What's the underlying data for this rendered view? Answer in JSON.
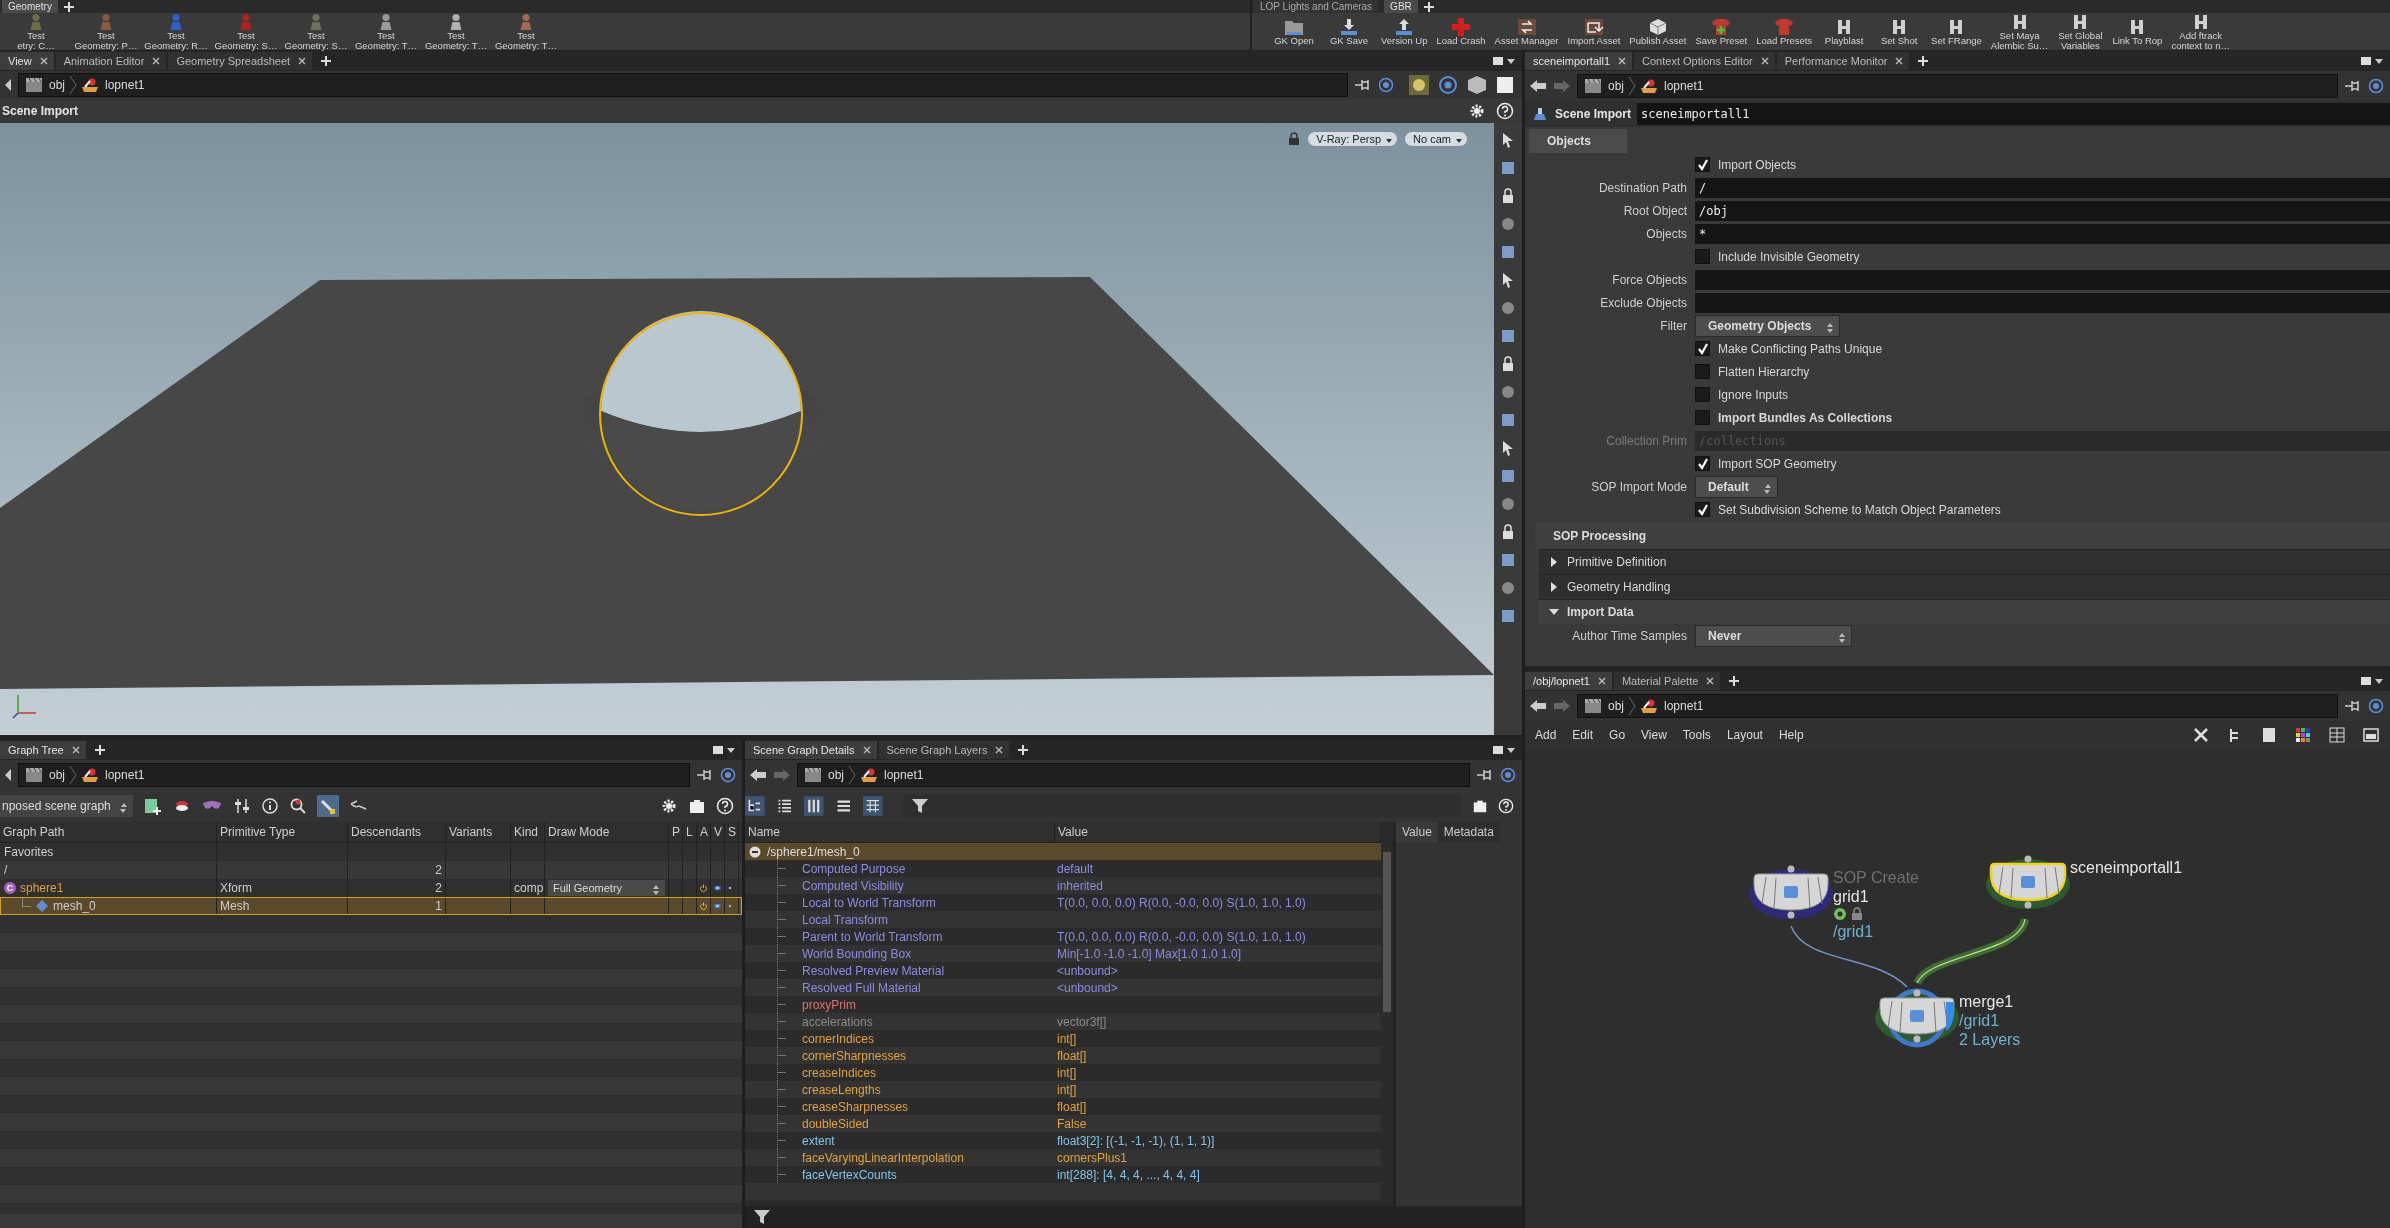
{
  "shelf_left": {
    "tabs": [
      {
        "label": "Geometry",
        "selected": true
      }
    ],
    "tools": [
      {
        "lines": [
          "Test",
          "etry: C…"
        ],
        "color": "#6e6a4a"
      },
      {
        "lines": [
          "Test",
          "Geometry: P…"
        ],
        "color": "#8a5a44"
      },
      {
        "lines": [
          "Test",
          "Geometry: R…"
        ],
        "color": "#2f5fd0"
      },
      {
        "lines": [
          "Test",
          "Geometry: S…"
        ],
        "color": "#b02222"
      },
      {
        "lines": [
          "Test",
          "Geometry: S…"
        ],
        "color": "#6f6f5e"
      },
      {
        "lines": [
          "Test",
          "Geometry: T…"
        ],
        "color": "#9a9a9a"
      },
      {
        "lines": [
          "Test",
          "Geometry: T…"
        ],
        "color": "#b0b0b0"
      },
      {
        "lines": [
          "Test",
          "Geometry: T…"
        ],
        "color": "#a06a50"
      }
    ]
  },
  "shelf_right": {
    "tabs": [
      {
        "label": "LOP Lights and Cameras",
        "selected": false
      },
      {
        "label": "GBR",
        "selected": true
      }
    ],
    "tools": [
      {
        "lines": [
          "GK Open"
        ],
        "kind": "folder"
      },
      {
        "lines": [
          "GK Save"
        ],
        "kind": "download"
      },
      {
        "lines": [
          "Version Up"
        ],
        "kind": "upload"
      },
      {
        "lines": [
          "Load Crash"
        ],
        "kind": "cross"
      },
      {
        "lines": [
          "Asset Manager"
        ],
        "kind": "swap"
      },
      {
        "lines": [
          "Import Asset"
        ],
        "kind": "import"
      },
      {
        "lines": [
          "Publish Asset"
        ],
        "kind": "box"
      },
      {
        "lines": [
          "Save Preset"
        ],
        "kind": "shirtplus"
      },
      {
        "lines": [
          "Load Presets"
        ],
        "kind": "shirt"
      },
      {
        "lines": [
          "Playblast"
        ],
        "kind": "helmet"
      },
      {
        "lines": [
          "Set Shot"
        ],
        "kind": "helmet"
      },
      {
        "lines": [
          "Set FRange"
        ],
        "kind": "helmet"
      },
      {
        "lines": [
          "Set Maya",
          "Alembic Su…"
        ],
        "kind": "helmet"
      },
      {
        "lines": [
          "Set Global",
          "Variables"
        ],
        "kind": "helmet"
      },
      {
        "lines": [
          "Link To Rop"
        ],
        "kind": "helmet"
      },
      {
        "lines": [
          "Add ftrack",
          "context to n…"
        ],
        "kind": "helmet"
      }
    ]
  },
  "viewer": {
    "tabs": [
      {
        "label": "View",
        "selected": true
      },
      {
        "label": "Animation Editor",
        "selected": false
      },
      {
        "label": "Geometry Spreadsheet",
        "selected": false
      }
    ],
    "path": [
      "obj",
      "lopnet1"
    ],
    "title": "Scene Import",
    "camera_menus": [
      "V-Ray: Persp",
      "No cam"
    ]
  },
  "scene_graph_tree": {
    "tabs": [
      {
        "label": "Graph Tree",
        "selected": true
      }
    ],
    "path": [
      "obj",
      "lopnet1"
    ],
    "view_menu": "nposed scene graph",
    "columns": [
      "Graph Path",
      "Primitive Type",
      "Descendants",
      "Variants",
      "Kind",
      "Draw Mode",
      "P",
      "L",
      "A",
      "V",
      "S"
    ],
    "rows": [
      {
        "kind": "favorites",
        "path": "Favorites",
        "selected": false
      },
      {
        "kind": "root",
        "path": "/",
        "descendants": "2",
        "selected": false
      },
      {
        "kind": "prim",
        "path": "sphere1",
        "badge": "C",
        "color": "#e0a040",
        "type": "Xform",
        "descendants": "2",
        "kind_label": "comp",
        "draw_mode": "Full Geometry",
        "active": true,
        "visible": true,
        "selected": false,
        "children": [
          {
            "kind": "prim",
            "path": "mesh_0",
            "type": "Mesh",
            "descendants": "1",
            "active": true,
            "visible": true,
            "selected": true
          }
        ]
      }
    ]
  },
  "scene_graph_details": {
    "tabs": [
      {
        "label": "Scene Graph Details",
        "selected": true
      },
      {
        "label": "Scene Graph Layers",
        "selected": false
      }
    ],
    "path": [
      "obj",
      "lopnet1"
    ],
    "columns": [
      "Name",
      "Value"
    ],
    "side_tabs": [
      {
        "label": "Value",
        "selected": true
      },
      {
        "label": "Metadata",
        "selected": false
      }
    ],
    "group": {
      "path": "/sphere1/mesh_0",
      "expanded": true
    },
    "items": [
      {
        "name": "Computed Purpose",
        "value": "default",
        "color": "#8d8be8"
      },
      {
        "name": "Computed Visibility",
        "value": "inherited",
        "color": "#8d8be8"
      },
      {
        "name": "Local to World Transform",
        "value": "T(0.0, 0.0, 0.0) R(0.0, -0.0, 0.0) S(1.0, 1.0, 1.0)",
        "color": "#8d8be8"
      },
      {
        "name": "Local Transform",
        "color": "#8d8be8"
      },
      {
        "name": "Parent to World Transform",
        "value": "T(0.0, 0.0, 0.0) R(0.0, -0.0, 0.0) S(1.0, 1.0, 1.0)",
        "color": "#8d8be8"
      },
      {
        "name": "World Bounding Box",
        "value": "Min[-1.0 -1.0 -1.0] Max[1.0 1.0 1.0]",
        "color": "#8d8be8"
      },
      {
        "name": "Resolved Preview Material",
        "value": "<unbound>",
        "color": "#8d8be8"
      },
      {
        "name": "Resolved Full Material",
        "value": "<unbound>",
        "color": "#8d8be8"
      },
      {
        "name": "proxyPrim",
        "color": "#e07070"
      },
      {
        "name": "accelerations",
        "value": "vector3f[]",
        "color": "#8c8c8c"
      },
      {
        "name": "cornerIndices",
        "value": "int[]",
        "color": "#e3a33e"
      },
      {
        "name": "cornerSharpnesses",
        "value": "float[]",
        "color": "#e3a33e"
      },
      {
        "name": "creaseIndices",
        "value": "int[]",
        "color": "#e3a33e"
      },
      {
        "name": "creaseLengths",
        "value": "int[]",
        "color": "#e3a33e"
      },
      {
        "name": "creaseSharpnesses",
        "value": "float[]",
        "color": "#e3a33e"
      },
      {
        "name": "doubleSided",
        "value": "False",
        "color": "#e3a33e"
      },
      {
        "name": "extent",
        "value": "float3[2]: [(-1, -1, -1), (1, 1, 1)]",
        "color": "#7ec6f2"
      },
      {
        "name": "faceVaryingLinearInterpolation",
        "value": "cornersPlus1",
        "color": "#e3a33e"
      },
      {
        "name": "faceVertexCounts",
        "value": "int[288]: [4, 4, 4, ..., 4, 4, 4]",
        "color": "#7ec6f2"
      }
    ]
  },
  "parameters": {
    "tabs": [
      {
        "label": "sceneimportall1",
        "selected": true
      },
      {
        "label": "Context Options Editor",
        "selected": false
      },
      {
        "label": "Performance Monitor",
        "selected": false
      }
    ],
    "path": [
      "obj",
      "lopnet1"
    ],
    "node_type": "Scene Import",
    "node_name": "sceneimportall1",
    "folder": "Objects",
    "rows": [
      {
        "kind": "checkbox",
        "label": "Import Objects",
        "checked": true
      },
      {
        "kind": "field",
        "label": "Destination Path",
        "value": "/"
      },
      {
        "kind": "field",
        "label": "Root Object",
        "value": "/obj"
      },
      {
        "kind": "field",
        "label": "Objects",
        "value": "*"
      },
      {
        "kind": "checkbox",
        "label": "Include Invisible Geometry",
        "checked": false
      },
      {
        "kind": "field",
        "label": "Force Objects"
      },
      {
        "kind": "field",
        "label": "Exclude Objects"
      },
      {
        "kind": "menu",
        "label": "Filter",
        "value": "Geometry Objects"
      },
      {
        "kind": "checkbox",
        "label": "Make Conflicting Paths Unique",
        "checked": true
      },
      {
        "kind": "checkbox",
        "label": "Flatten Hierarchy",
        "checked": false
      },
      {
        "kind": "checkbox",
        "label": "Ignore Inputs",
        "checked": false
      },
      {
        "kind": "checkbox",
        "label": "Import Bundles As Collections",
        "checked": false,
        "bold": true
      },
      {
        "kind": "field",
        "label": "Collection Prim",
        "placeholder": "/collections",
        "disabled": true
      },
      {
        "kind": "checkbox",
        "label": "Import SOP Geometry",
        "checked": true
      },
      {
        "kind": "menu",
        "label": "SOP Import Mode",
        "value": "Default"
      },
      {
        "kind": "checkbox",
        "label": "Set Subdivision Scheme to Match Object Parameters",
        "checked": true
      }
    ],
    "section": "SOP Processing",
    "folders": [
      {
        "label": "Primitive Definition",
        "expanded": false
      },
      {
        "label": "Geometry Handling",
        "expanded": false
      },
      {
        "label": "Import Data",
        "expanded": true
      }
    ],
    "trailing_row": {
      "label": "Author Time Samples",
      "value": "Never"
    }
  },
  "network": {
    "tabs": [
      {
        "label": "/obj/lopnet1",
        "selected": true
      },
      {
        "label": "Material Palette",
        "selected": false
      }
    ],
    "path": [
      "obj",
      "lopnet1"
    ],
    "menu": [
      "Add",
      "Edit",
      "Go",
      "View",
      "Tools",
      "Layout",
      "Help"
    ],
    "nodes": [
      {
        "name": "grid1",
        "type_label": "SOP Create",
        "info": [
          "/grid1"
        ],
        "color": "#2f2a78",
        "selected": false,
        "display": false,
        "locked": true
      },
      {
        "name": "sceneimportall1",
        "color": "#2f5a2f",
        "selected": true,
        "display": false,
        "locked": false
      },
      {
        "name": "merge1",
        "info": [
          "/grid1",
          "2 Layers"
        ],
        "color": "#2f5a2f",
        "selected": false,
        "display": true,
        "locked": false
      }
    ]
  }
}
